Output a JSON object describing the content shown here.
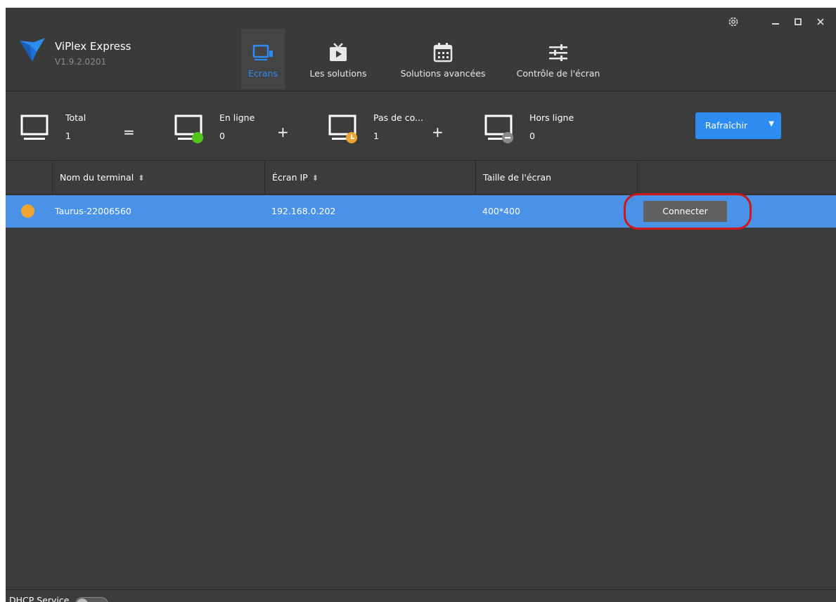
{
  "app": {
    "name": "ViPlex Express",
    "version": "V1.9.2.0201"
  },
  "nav": [
    {
      "label": "Ecrans",
      "icon": "screen-icon",
      "active": true
    },
    {
      "label": "Les solutions",
      "icon": "tv-play-icon",
      "active": false
    },
    {
      "label": "Solutions avancées",
      "icon": "calendar-icon",
      "active": false
    },
    {
      "label": "Contrôle de l'écran",
      "icon": "sliders-icon",
      "active": false
    }
  ],
  "window_controls": {
    "settings": "settings-icon",
    "minimize": "minimize-icon",
    "maximize": "maximize-icon",
    "close": "close-icon"
  },
  "summary": {
    "total": {
      "label": "Total",
      "value": "1"
    },
    "eq": "=",
    "online": {
      "label": "En ligne",
      "value": "0",
      "status_color": "#52c41a"
    },
    "plus1": "+",
    "pending": {
      "label": "Pas de co...",
      "value": "1",
      "status_color": "#f0a430"
    },
    "plus2": "+",
    "offline": {
      "label": "Hors ligne",
      "value": "0",
      "status_color": "#8a8a8a"
    }
  },
  "refresh": {
    "label": "Rafraîchir"
  },
  "table": {
    "columns": [
      "Nom du terminal",
      "Écran IP",
      "Taille de l'écran"
    ],
    "rows": [
      {
        "name": "Taurus-22006560",
        "ip": "192.168.0.202",
        "size": "400*400",
        "status_color": "#f0a430",
        "action": "Connecter"
      }
    ]
  },
  "footer": {
    "dhcp_label": "DHCP Service",
    "dhcp_enabled": false
  },
  "colors": {
    "accent": "#2d8cf0",
    "selected_row": "#4a92e8",
    "background": "#3c3c3c",
    "highlight_circle": "#d01717"
  }
}
